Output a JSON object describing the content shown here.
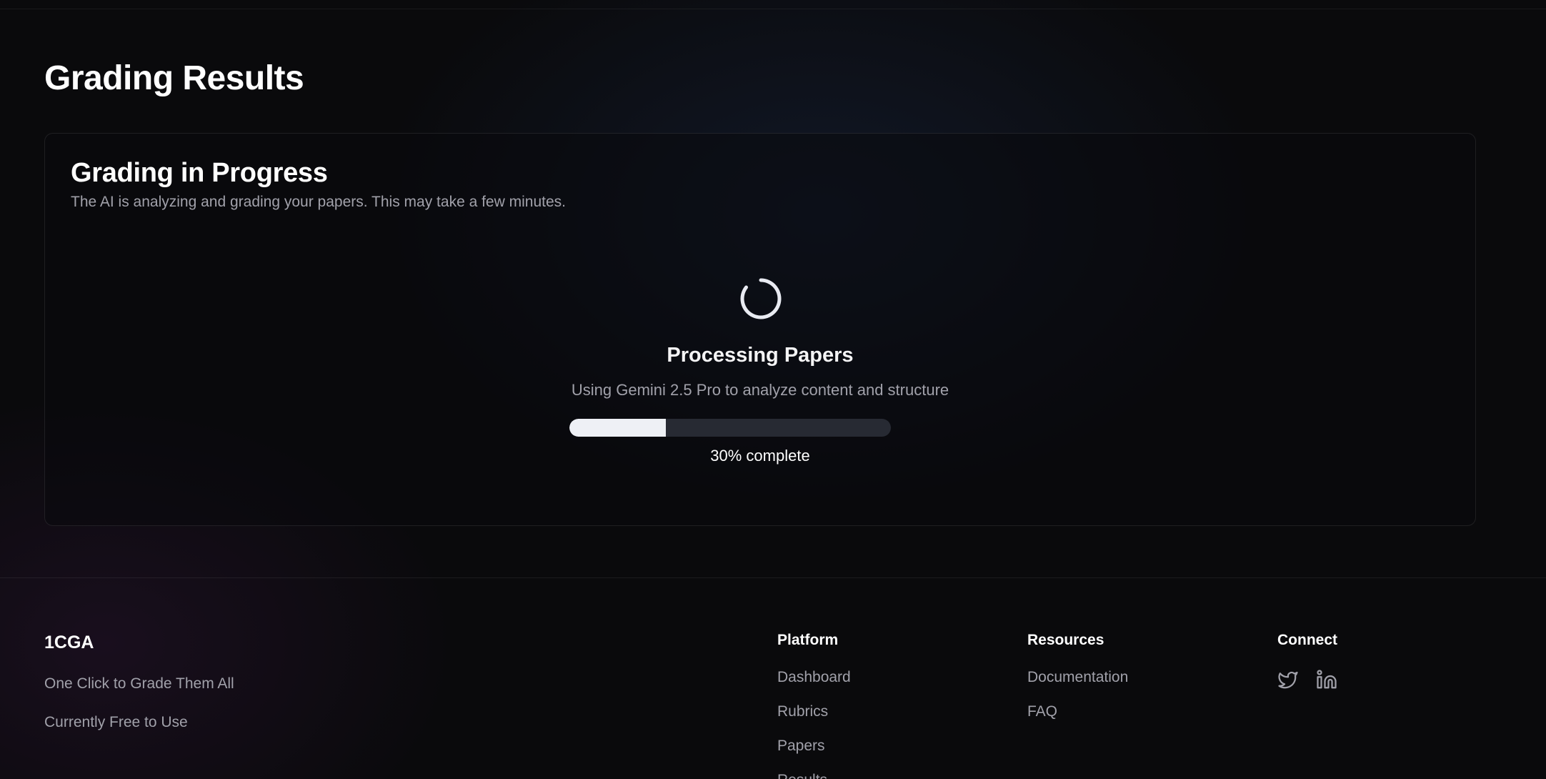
{
  "header": {
    "title": "Grading Results"
  },
  "card": {
    "title": "Grading in Progress",
    "description": "The AI is analyzing and grading your papers. This may take a few minutes.",
    "status_title": "Processing Papers",
    "status_subtitle": "Using Gemini 2.5 Pro to analyze content and structure",
    "progress_percent": 30,
    "progress_label": "30% complete",
    "spinner_icon": "loader-spinner-icon"
  },
  "footer": {
    "brand": "1CGA",
    "tagline_1": "One Click to Grade Them All",
    "tagline_2": "Currently Free to Use",
    "columns": [
      {
        "heading": "Platform",
        "links": [
          "Dashboard",
          "Rubrics",
          "Papers",
          "Results"
        ]
      },
      {
        "heading": "Resources",
        "links": [
          "Documentation",
          "FAQ"
        ]
      },
      {
        "heading": "Connect",
        "icons": [
          "twitter-icon",
          "linkedin-icon"
        ]
      }
    ]
  },
  "colors": {
    "background": "#0a0a0c",
    "muted_text": "#a1a1aa",
    "progress_track": "#272a33",
    "progress_fill": "#eef0f5"
  }
}
